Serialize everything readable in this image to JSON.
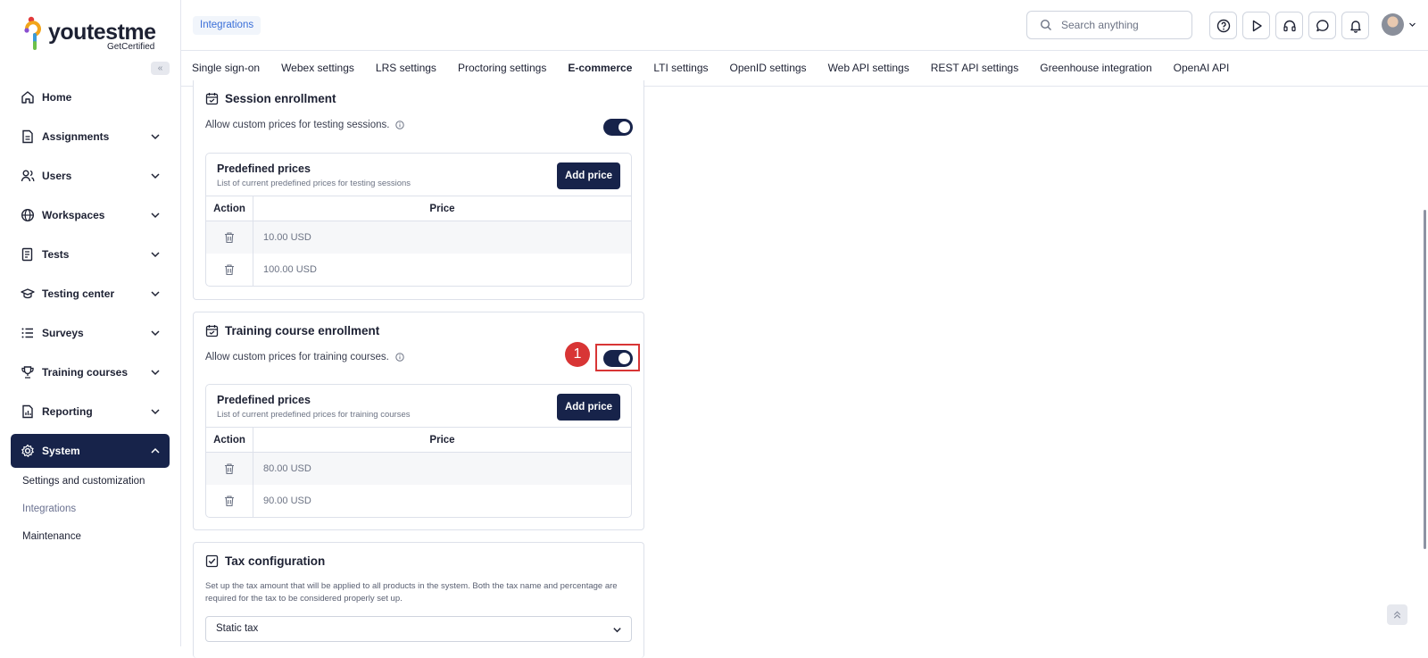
{
  "brand": {
    "name": "youtestme",
    "tagline": "GetCertified"
  },
  "sidebar": {
    "items": [
      {
        "label": "Home"
      },
      {
        "label": "Assignments"
      },
      {
        "label": "Users"
      },
      {
        "label": "Workspaces"
      },
      {
        "label": "Tests"
      },
      {
        "label": "Testing center"
      },
      {
        "label": "Surveys"
      },
      {
        "label": "Training courses"
      },
      {
        "label": "Reporting"
      },
      {
        "label": "System"
      }
    ],
    "sub_items": [
      {
        "label": "Settings and customization"
      },
      {
        "label": "Integrations"
      },
      {
        "label": "Maintenance"
      }
    ]
  },
  "header": {
    "breadcrumb": "Integrations",
    "search_placeholder": "Search anything"
  },
  "tabs": [
    {
      "label": "Single sign-on"
    },
    {
      "label": "Webex settings"
    },
    {
      "label": "LRS settings"
    },
    {
      "label": "Proctoring settings"
    },
    {
      "label": "E-commerce"
    },
    {
      "label": "LTI settings"
    },
    {
      "label": "OpenID settings"
    },
    {
      "label": "Web API settings"
    },
    {
      "label": "REST API settings"
    },
    {
      "label": "Greenhouse integration"
    },
    {
      "label": "OpenAI API"
    }
  ],
  "session": {
    "title": "Session enrollment",
    "setting": "Allow custom prices for testing sessions.",
    "prices_title": "Predefined prices",
    "prices_sub": "List of current predefined prices for testing sessions",
    "add_label": "Add price",
    "col_action": "Action",
    "col_price": "Price",
    "rows": [
      {
        "price": "10.00 USD"
      },
      {
        "price": "100.00 USD"
      }
    ]
  },
  "training": {
    "title": "Training course enrollment",
    "setting": "Allow custom prices for training courses.",
    "prices_title": "Predefined prices",
    "prices_sub": "List of current predefined prices for training courses",
    "add_label": "Add price",
    "col_action": "Action",
    "col_price": "Price",
    "rows": [
      {
        "price": "80.00 USD"
      },
      {
        "price": "90.00 USD"
      }
    ]
  },
  "tax": {
    "title": "Tax configuration",
    "description": "Set up the tax amount that will be applied to all products in the system. Both the tax name and percentage are required for the tax to be considered properly set up.",
    "selected": "Static tax"
  },
  "annotation": {
    "marker": "1"
  },
  "colors": {
    "primary": "#17234a",
    "accent": "#3a6fd8",
    "highlight": "#d83535"
  }
}
